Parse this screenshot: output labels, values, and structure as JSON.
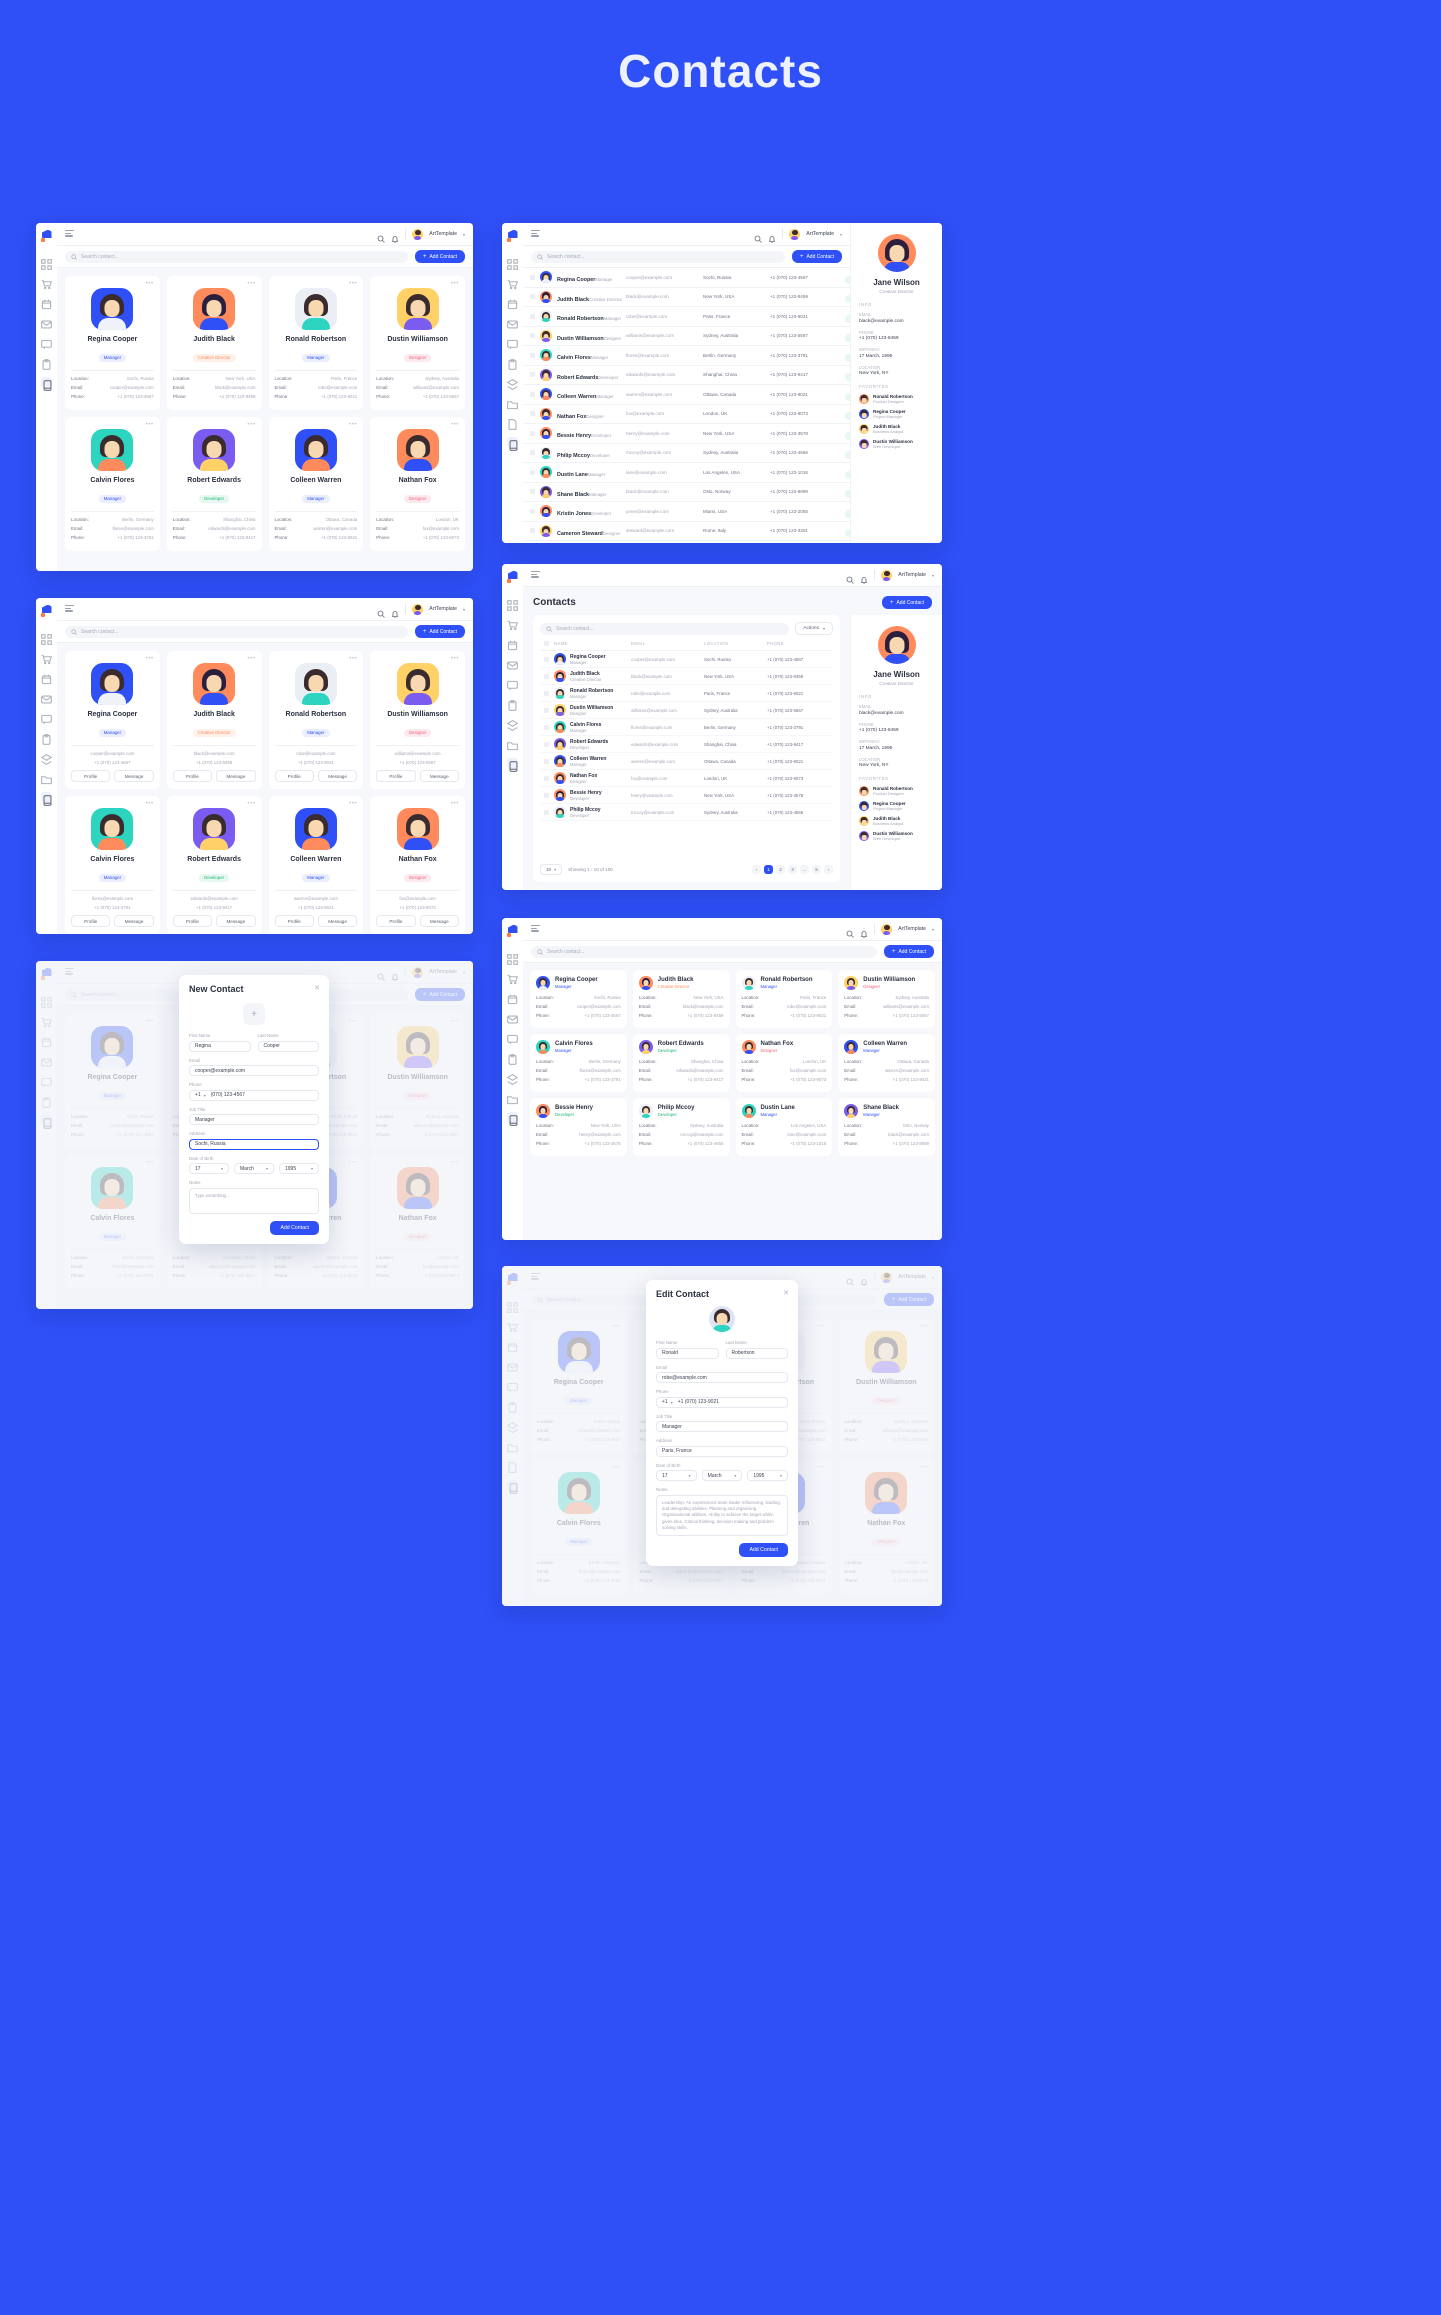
{
  "page": {
    "title": "Contacts",
    "bg": "#2f50f7"
  },
  "colors": {
    "primary": "#2f50f7",
    "accentOrange": "#ff7a45",
    "statusGreen": "#21b573",
    "roleManager": "#2f50f7",
    "roleDesigner": "#f0637c",
    "roleDeveloper": "#21b573",
    "roleCreative": "#ff8a5b"
  },
  "topbar": {
    "brand": "ArtTemplate",
    "caret": "▾",
    "icons": [
      "search-icon",
      "bell-icon"
    ]
  },
  "search": {
    "placeholder": "Search contact..."
  },
  "buttons": {
    "add_contact": "Add Contact",
    "plus": "+",
    "profile": "Profile",
    "message": "Message",
    "actions": "Actions",
    "add_contact_modal": "Add Contact"
  },
  "card_labels": {
    "location": "Location:",
    "email": "Email:",
    "phone": "Phone:"
  },
  "sidebar_icons": [
    "grid-icon",
    "cart-icon",
    "calendar-icon",
    "mail-icon",
    "chat-icon",
    "clipboard-icon",
    "layers-icon",
    "folder-icon",
    "file-icon",
    "book-icon"
  ],
  "contacts": [
    {
      "name": "Regina Cooper",
      "role": "Manager",
      "email": "cooper@example.com",
      "location": "Sochi, Russia",
      "phone": "+1 (070) 123-4567",
      "status": "Active",
      "avatarBg": "#2f50f7",
      "hair": "#3a2b2e",
      "body": "#f0f2fa"
    },
    {
      "name": "Judith Black",
      "role": "Creative Director",
      "email": "black@example.com",
      "location": "New York, USA",
      "phone": "+1 (070) 123-8459",
      "status": "Active",
      "avatarBg": "#ff8a5b",
      "hair": "#2a1f3d",
      "body": "#2f50f7"
    },
    {
      "name": "Ronald Robertson",
      "role": "Manager",
      "email": "robe@example.com",
      "location": "Paris, France",
      "phone": "+1 (070) 123-9021",
      "status": "Active",
      "avatarBg": "#eceef6",
      "hair": "#3a2b2e",
      "body": "#2dd4bf"
    },
    {
      "name": "Dustin Williamson",
      "role": "Designer",
      "email": "williams@example.com",
      "location": "Sydney, Australia",
      "phone": "+1 (070) 123-5567",
      "status": "Active",
      "avatarBg": "#ffd166",
      "hair": "#3a2b2e",
      "body": "#7b5cf0"
    },
    {
      "name": "Calvin Flores",
      "role": "Manager",
      "email": "flores@example.com",
      "location": "Berlin, Germany",
      "phone": "+1 (070) 123-3791",
      "status": "Active",
      "avatarBg": "#2dd4bf",
      "hair": "#3a2b2e",
      "body": "#ff8a5b"
    },
    {
      "name": "Robert Edwards",
      "role": "Developer",
      "email": "edwards@example.com",
      "location": "Shanghai, China",
      "phone": "+1 (070) 123-9417",
      "status": "Active",
      "avatarBg": "#7b5cf0",
      "hair": "#3a2b2e",
      "body": "#ffd166"
    },
    {
      "name": "Colleen Warren",
      "role": "Manager",
      "email": "warren@example.com",
      "location": "Ottawa, Canada",
      "phone": "+1 (070) 123-9021",
      "status": "Active",
      "avatarBg": "#2f50f7",
      "hair": "#3a2b2e",
      "body": "#ff8a5b"
    },
    {
      "name": "Nathan Fox",
      "role": "Designer",
      "email": "fox@example.com",
      "location": "London, UK",
      "phone": "+1 (070) 123-9073",
      "status": "Active",
      "avatarBg": "#ff8a5b",
      "hair": "#3a2b2e",
      "body": "#2f50f7"
    },
    {
      "name": "Bessie Henry",
      "role": "Developer",
      "email": "henry@example.com",
      "location": "New York, USA",
      "phone": "+1 (070) 123-3578",
      "status": "Active",
      "avatarBg": "#ff8a5b",
      "hair": "#2a1f3d",
      "body": "#2f50f7"
    },
    {
      "name": "Philip Mccoy",
      "role": "Developer",
      "email": "mccoy@example.com",
      "location": "Sydney, Australia",
      "phone": "+1 (070) 123-4566",
      "status": "Active",
      "avatarBg": "#eceef6",
      "hair": "#3a2b2e",
      "body": "#2dd4bf"
    },
    {
      "name": "Dustin Lane",
      "role": "Manager",
      "email": "lane@example.com",
      "location": "Los Angeles, USA",
      "phone": "+1 (070) 123-1016",
      "status": "Active",
      "avatarBg": "#2dd4bf",
      "hair": "#3a2b2e",
      "body": "#ff8a5b"
    },
    {
      "name": "Shane Black",
      "role": "Manager",
      "email": "black@example.com",
      "location": "Oslo, Norway",
      "phone": "+1 (070) 123-8899",
      "status": "Active",
      "avatarBg": "#7b5cf0",
      "hair": "#3a2b2e",
      "body": "#ffd166"
    },
    {
      "name": "Kristin Jones",
      "role": "Developer",
      "email": "jones@example.com",
      "location": "Miami, USA",
      "phone": "+1 (070) 123-2055",
      "status": "Active",
      "avatarBg": "#ff8a5b",
      "hair": "#2a1f3d",
      "body": "#2f50f7"
    },
    {
      "name": "Cameron Steward",
      "role": "Designer",
      "email": "steward@example.com",
      "location": "Rome, Italy",
      "phone": "+1 (070) 123-3301",
      "status": "Active",
      "avatarBg": "#ffd166",
      "hair": "#3a2b2e",
      "body": "#7b5cf0"
    }
  ],
  "detail": {
    "name": "Jane Wilson",
    "role": "Creative Director",
    "info_label": "INFO",
    "fields": [
      {
        "key": "EMAIL",
        "value": "black@example.com"
      },
      {
        "key": "PHONE",
        "value": "+1 (070) 123-8459"
      },
      {
        "key": "BIRTHDAY",
        "value": "17 March, 1995"
      },
      {
        "key": "LOCATION",
        "value": "New York, NY"
      }
    ],
    "favorites_label": "FAVORITES",
    "favorites": [
      {
        "name": "Ronald Robertson",
        "role": "Product Designer",
        "bg": "#ff8a5b"
      },
      {
        "name": "Regina Cooper",
        "role": "Project Manager",
        "bg": "#2f50f7"
      },
      {
        "name": "Judith Black",
        "role": "Business Analyst",
        "bg": "#ffd166"
      },
      {
        "name": "Dustin Williamson",
        "role": "Web Developer",
        "bg": "#7b5cf0"
      }
    ]
  },
  "table": {
    "page_title": "Contacts",
    "columns": [
      "NAME",
      "EMAIL",
      "LOCATION",
      "PHONE"
    ],
    "showing": "Showing 1 - 10 of 100",
    "rows_per_page": "10",
    "pages": [
      "1",
      "2",
      "3",
      "...",
      "5"
    ],
    "active_page": "1",
    "prev": "‹",
    "next": "›"
  },
  "new_contact_modal": {
    "title": "New Contact",
    "close": "✕",
    "plus": "+",
    "first_name_label": "First Name",
    "first_name_value": "Regina",
    "last_name_label": "Last Name",
    "last_name_value": "Cooper",
    "email_label": "Email",
    "email_value": "cooper@example.com",
    "phone_label": "Phone",
    "phone_code": "+1",
    "phone_value": "(070) 123-4567",
    "job_label": "Job Title",
    "job_value": "Manager",
    "address_label": "Address",
    "address_value": "Sochi, Russia",
    "dob_label": "Date of Birth",
    "dob_day": "17",
    "dob_month": "March",
    "dob_year": "1995",
    "notes_label": "Notes",
    "notes_placeholder": "Type something...",
    "submit": "Add Contact"
  },
  "edit_contact_modal": {
    "title": "Edit Contact",
    "close": "✕",
    "first_name_label": "First Name",
    "first_name_value": "Ronald",
    "last_name_label": "Last Name",
    "last_name_value": "Robertson",
    "email_label": "Email",
    "email_value": "robe@example.com",
    "phone_label": "Phone",
    "phone_code": "+1",
    "phone_value": "+1 (070) 123-9021",
    "job_label": "Job Title",
    "job_value": "Manager",
    "address_label": "Address",
    "address_value": "Paris, France",
    "dob_label": "Date of Birth",
    "dob_day": "17",
    "dob_month": "March",
    "dob_year": "1995",
    "notes_label": "Notes",
    "notes_value": "Leadership: An experienced team leader influencing, leading, and delegating abilities. Planning and organising - Organisational abilities. Ability to achieve the target within given time. Critical thinking, decision making and problem solving skills.",
    "submit": "Add Contact"
  }
}
